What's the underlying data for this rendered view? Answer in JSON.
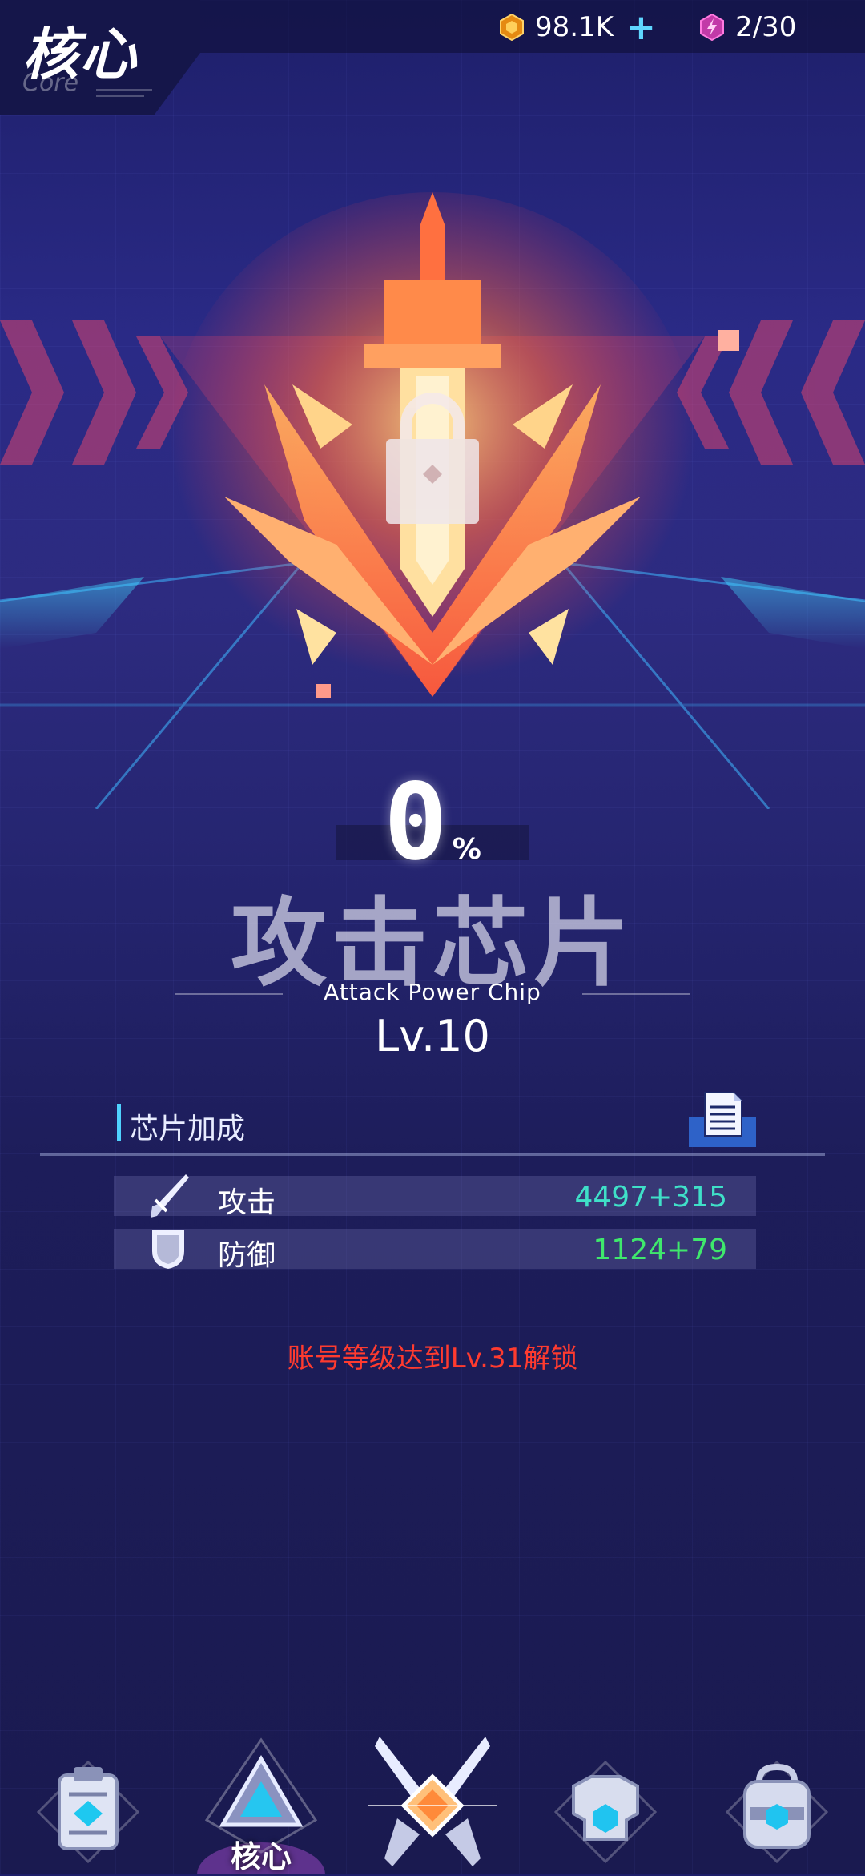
{
  "header": {
    "title_cn": "核心",
    "title_en": "Core",
    "gold": "98.1K",
    "gold_plus": "+",
    "energy": "2/30"
  },
  "chip": {
    "progress_number": "0",
    "progress_symbol": "%",
    "progress_percent": 0,
    "name_cn": "攻击芯片",
    "name_en": "Attack Power Chip",
    "level": "Lv.10"
  },
  "bonus": {
    "section_title": "芯片加成",
    "stats": [
      {
        "label": "攻击",
        "value": "4497+315",
        "icon": "sword-icon"
      },
      {
        "label": "防御",
        "value": "1124+79",
        "icon": "shield-icon"
      }
    ]
  },
  "unlock_message": "账号等级达到Lv.31解锁",
  "nav": {
    "active_label": "核心",
    "items": [
      "clipboard-icon",
      "core-triangle-icon",
      "crossed-swords-icon",
      "armor-icon",
      "backpack-icon"
    ]
  },
  "colors": {
    "accent": "#4fd2ff",
    "stat_attack": "#3fe0c8",
    "stat_defense": "#3fe86c",
    "warning": "#ff3b2f",
    "emblem": "#ff7a3a"
  }
}
